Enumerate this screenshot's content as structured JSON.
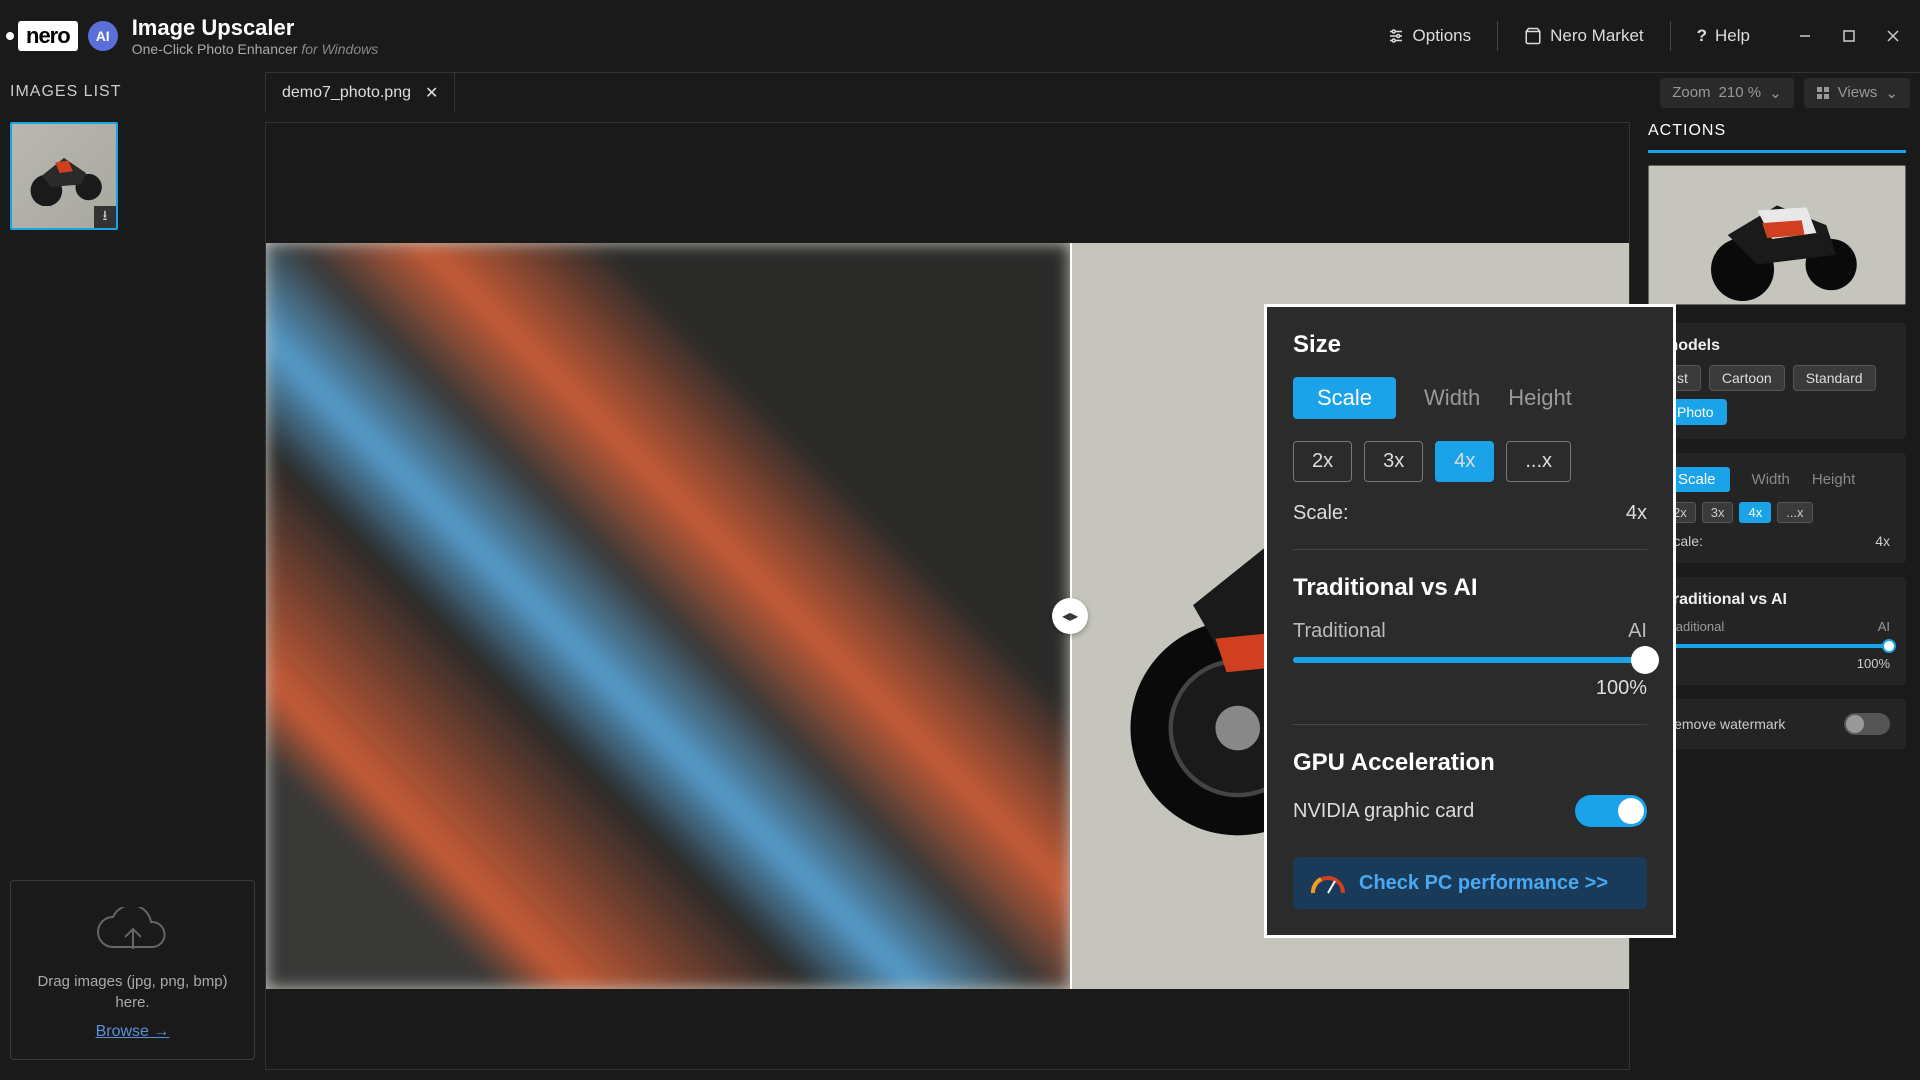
{
  "app": {
    "brand": "nero",
    "ai_badge": "AI",
    "title": "Image Upscaler",
    "subtitle": "One-Click Photo Enhancer",
    "platform": "for Windows"
  },
  "titlebar": {
    "options": "Options",
    "market": "Nero Market",
    "help": "Help"
  },
  "sidebar": {
    "header": "IMAGES LIST",
    "dropzone_line": "Drag images (jpg, png, bmp) here.",
    "browse": "Browse →"
  },
  "tab": {
    "filename": "demo7_photo.png"
  },
  "viewbar": {
    "zoom_label": "Zoom",
    "zoom_value": "210 %",
    "views": "Views"
  },
  "actions": {
    "header": "ACTIONS",
    "models_title": "models",
    "models": [
      "st",
      "Cartoon",
      "Standard"
    ],
    "model_photo": "Photo",
    "size_tabs": [
      "Scale",
      "Width",
      "Height"
    ],
    "scale_opts": [
      "2x",
      "3x",
      "4x",
      "...x"
    ],
    "scale_label": "Scale:",
    "scale_value": "4x",
    "tva_title": "Traditional vs AI",
    "tva_left": "Traditional",
    "tva_right": "AI",
    "tva_pct": "100%",
    "watermark": "Remove watermark"
  },
  "popup": {
    "size_title": "Size",
    "segs": [
      "Scale",
      "Width",
      "Height"
    ],
    "scales": [
      "2x",
      "3x",
      "4x",
      "...x"
    ],
    "scale_label": "Scale:",
    "scale_value": "4x",
    "tva_title": "Traditional vs AI",
    "tva_left": "Traditional",
    "tva_right": "AI",
    "tva_pct": "100%",
    "gpu_title": "GPU Acceleration",
    "gpu_card": "NVIDIA graphic card",
    "check_perf": "Check PC performance >>"
  }
}
